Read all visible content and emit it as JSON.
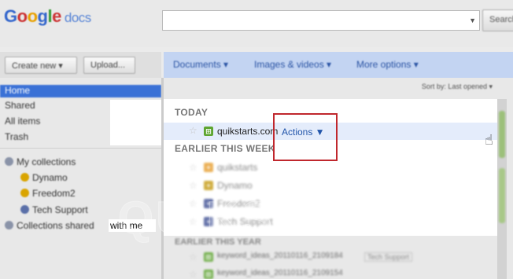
{
  "app": {
    "logo_text": "Google",
    "logo_suffix": "docs"
  },
  "search": {
    "placeholder": "",
    "button_label": "Search"
  },
  "toolbar": {
    "create_label": "Create new ▾",
    "upload_label": "Upload..."
  },
  "menus": {
    "documents": "Documents ▾",
    "images_videos": "Images & videos ▾",
    "more_options": "More options ▾"
  },
  "sidebar": {
    "items": [
      {
        "label": "Home"
      },
      {
        "label": "Shared"
      },
      {
        "label": "All items"
      },
      {
        "label": "Trash"
      }
    ],
    "collections": {
      "my_label": "My collections",
      "children": [
        {
          "label": "Dynamo",
          "color": "#d9a400"
        },
        {
          "label": "Freedom2",
          "color": "#d9a400"
        },
        {
          "label": "Tech Support",
          "color": "#5a6fa8"
        }
      ],
      "shared_label_start": "Collections shared ",
      "shared_label_end": "with me"
    }
  },
  "main": {
    "settings_link": "Sort by: Last opened ▾",
    "today_heading": "TODAY",
    "today_items": [
      {
        "name": "quikstarts.com",
        "icon": "spreadsheet-icon",
        "color": "#5ea530"
      }
    ],
    "actions_label": "Actions ▼",
    "week_heading": "EARLIER THIS WEEK",
    "week_items": [
      {
        "name": "quikstarts",
        "icon": "presentation-icon",
        "color": "#e8a33a"
      },
      {
        "name": "Dynamo",
        "icon": "drawing-icon",
        "color": "#c8a020"
      },
      {
        "name": "Freedom2",
        "icon": "drawing-icon",
        "color": "#4a5a9a"
      },
      {
        "name": "Tech Support",
        "icon": "drawing-icon",
        "color": "#4a5a9a"
      }
    ],
    "year_heading": "EARLIER THIS YEAR",
    "year_items": [
      {
        "name": "keyword_ideas_20110116_2109184",
        "tag": "Tech Support",
        "color": "#5ea530"
      },
      {
        "name": "keyword_ideas_20110116_2109154",
        "tag": "",
        "color": "#5ea530"
      }
    ]
  },
  "watermark": "QUIKSTARTS"
}
